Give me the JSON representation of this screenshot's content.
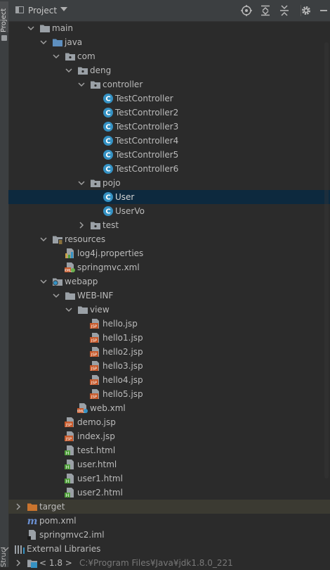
{
  "side_tabs": {
    "project": "Project",
    "structure": "Structure"
  },
  "header": {
    "title": "Project"
  },
  "toolbar_icons": [
    "locate-icon",
    "expand-all-icon",
    "collapse-all-icon",
    "gear-icon",
    "minimize-icon"
  ],
  "tree": [
    {
      "label": "main",
      "indent": 0,
      "arrow": "open",
      "icon": "folder",
      "name": "main-folder"
    },
    {
      "label": "java",
      "indent": 1,
      "arrow": "open",
      "icon": "folder-blue",
      "name": "java-source-folder"
    },
    {
      "label": "com",
      "indent": 2,
      "arrow": "open",
      "icon": "package",
      "name": "com-package"
    },
    {
      "label": "deng",
      "indent": 3,
      "arrow": "open",
      "icon": "package",
      "name": "deng-package"
    },
    {
      "label": "controller",
      "indent": 4,
      "arrow": "open",
      "icon": "package",
      "name": "controller-package"
    },
    {
      "label": "TestController",
      "indent": 5,
      "arrow": "none",
      "icon": "class",
      "name": "testcontroller-class"
    },
    {
      "label": "TestController2",
      "indent": 5,
      "arrow": "none",
      "icon": "class",
      "name": "testcontroller2-class"
    },
    {
      "label": "TestController3",
      "indent": 5,
      "arrow": "none",
      "icon": "class",
      "name": "testcontroller3-class"
    },
    {
      "label": "TestController4",
      "indent": 5,
      "arrow": "none",
      "icon": "class",
      "name": "testcontroller4-class"
    },
    {
      "label": "TestController5",
      "indent": 5,
      "arrow": "none",
      "icon": "class",
      "name": "testcontroller5-class"
    },
    {
      "label": "TestController6",
      "indent": 5,
      "arrow": "none",
      "icon": "class",
      "name": "testcontroller6-class"
    },
    {
      "label": "pojo",
      "indent": 4,
      "arrow": "open",
      "icon": "package",
      "name": "pojo-package"
    },
    {
      "label": "User",
      "indent": 5,
      "arrow": "none",
      "icon": "class",
      "name": "user-class",
      "selected": true
    },
    {
      "label": "UserVo",
      "indent": 5,
      "arrow": "none",
      "icon": "class",
      "name": "uservo-class"
    },
    {
      "label": "test",
      "indent": 4,
      "arrow": "closed",
      "icon": "package",
      "name": "test-package"
    },
    {
      "label": "resources",
      "indent": 1,
      "arrow": "open",
      "icon": "folder-res",
      "name": "resources-folder"
    },
    {
      "label": "log4j.properties",
      "indent": 2,
      "arrow": "none",
      "icon": "properties",
      "name": "log4j-properties-file"
    },
    {
      "label": "springmvc.xml",
      "indent": 2,
      "arrow": "none",
      "icon": "spring-xml",
      "name": "springmvc-xml-file"
    },
    {
      "label": "webapp",
      "indent": 1,
      "arrow": "open",
      "icon": "folder-web",
      "name": "webapp-folder"
    },
    {
      "label": "WEB-INF",
      "indent": 2,
      "arrow": "open",
      "icon": "folder",
      "name": "web-inf-folder"
    },
    {
      "label": "view",
      "indent": 3,
      "arrow": "open",
      "icon": "folder",
      "name": "view-folder"
    },
    {
      "label": "hello.jsp",
      "indent": 4,
      "arrow": "none",
      "icon": "jsp",
      "name": "hello-jsp-file"
    },
    {
      "label": "hello1.jsp",
      "indent": 4,
      "arrow": "none",
      "icon": "jsp",
      "name": "hello1-jsp-file"
    },
    {
      "label": "hello2.jsp",
      "indent": 4,
      "arrow": "none",
      "icon": "jsp",
      "name": "hello2-jsp-file"
    },
    {
      "label": "hello3.jsp",
      "indent": 4,
      "arrow": "none",
      "icon": "jsp",
      "name": "hello3-jsp-file"
    },
    {
      "label": "hello4.jsp",
      "indent": 4,
      "arrow": "none",
      "icon": "jsp",
      "name": "hello4-jsp-file"
    },
    {
      "label": "hello5.jsp",
      "indent": 4,
      "arrow": "none",
      "icon": "jsp",
      "name": "hello5-jsp-file"
    },
    {
      "label": "web.xml",
      "indent": 3,
      "arrow": "none",
      "icon": "web-xml",
      "name": "web-xml-file"
    },
    {
      "label": "demo.jsp",
      "indent": 2,
      "arrow": "none",
      "icon": "jsp",
      "name": "demo-jsp-file"
    },
    {
      "label": "index.jsp",
      "indent": 2,
      "arrow": "none",
      "icon": "jsp",
      "name": "index-jsp-file"
    },
    {
      "label": "test.html",
      "indent": 2,
      "arrow": "none",
      "icon": "html",
      "name": "test-html-file"
    },
    {
      "label": "user.html",
      "indent": 2,
      "arrow": "none",
      "icon": "html",
      "name": "user-html-file"
    },
    {
      "label": "user1.html",
      "indent": 2,
      "arrow": "none",
      "icon": "html",
      "name": "user1-html-file"
    },
    {
      "label": "user2.html",
      "indent": 2,
      "arrow": "none",
      "icon": "html",
      "name": "user2-html-file"
    },
    {
      "label": "target",
      "indent": -1,
      "arrow": "closed",
      "icon": "folder-orange",
      "name": "target-folder",
      "excluded": true
    },
    {
      "label": "pom.xml",
      "indent": -1,
      "arrow": "none",
      "icon": "maven",
      "name": "pom-xml-file"
    },
    {
      "label": "springmvc2.iml",
      "indent": -1,
      "arrow": "none",
      "icon": "iml",
      "name": "springmvc2-iml-file"
    },
    {
      "label": "External Libraries",
      "indent": -2,
      "arrow": "open",
      "icon": "libraries",
      "name": "external-libraries"
    },
    {
      "label": "< 1.8 >",
      "sub": "C:¥Program Files¥Java¥jdk1.8.0_221",
      "indent": -1,
      "arrow": "closed",
      "icon": "jdk",
      "name": "jdk-1-8-library",
      "partial": true
    }
  ],
  "colors": {
    "selection": "#0d293e",
    "excluded": "#3b3a32",
    "class_icon": "#3592c4",
    "jsp_icon": "#c75a2c",
    "html_icon": "#4f9e3a"
  }
}
